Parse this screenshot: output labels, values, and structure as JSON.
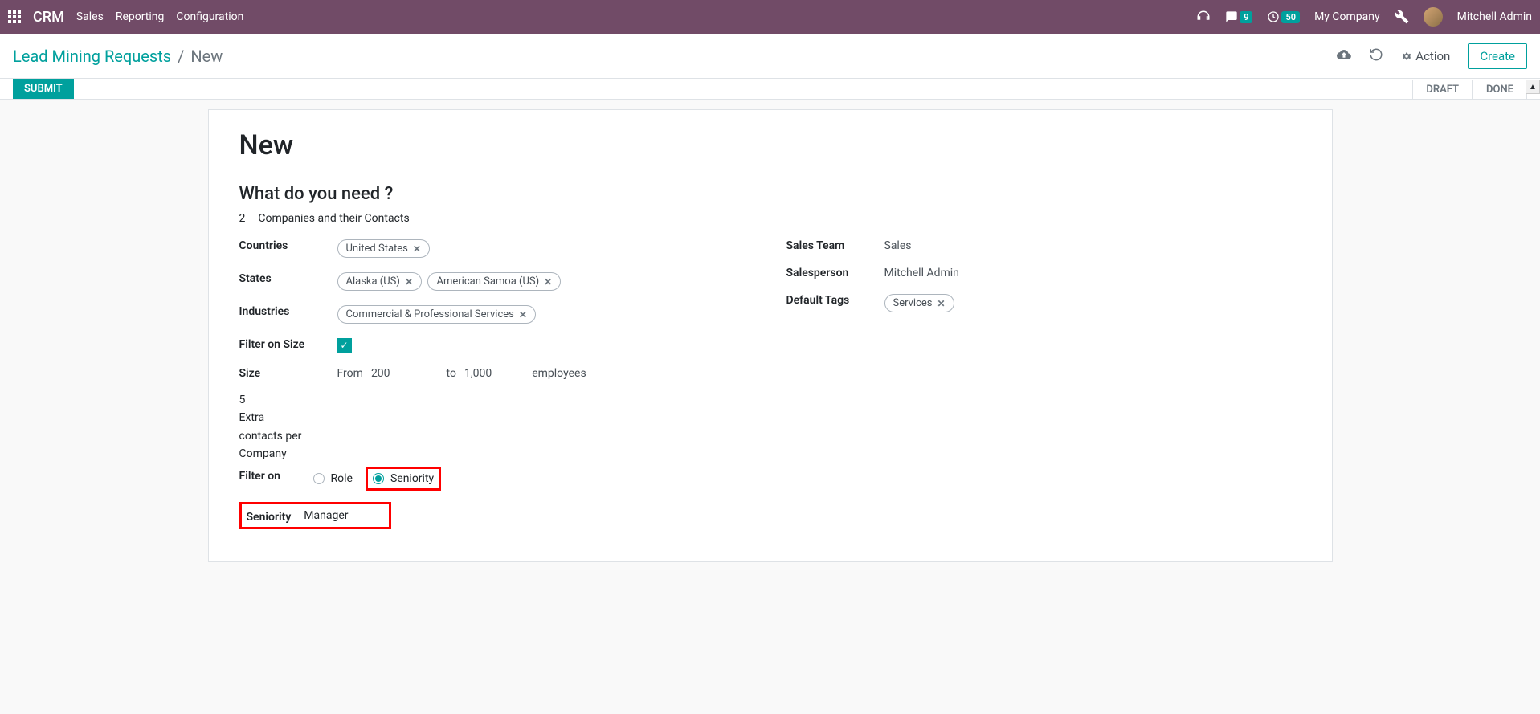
{
  "topbar": {
    "app_name": "CRM",
    "nav": [
      "Sales",
      "Reporting",
      "Configuration"
    ],
    "messages_count": "9",
    "timer_count": "50",
    "company": "My Company",
    "username": "Mitchell Admin"
  },
  "subheader": {
    "breadcrumb_root": "Lead Mining Requests",
    "breadcrumb_sep": "/",
    "breadcrumb_current": "New",
    "action_label": "Action",
    "create_label": "Create"
  },
  "status": {
    "submit_label": "SUBMIT",
    "stage_draft": "DRAFT",
    "stage_done": "DONE"
  },
  "form": {
    "title": "New",
    "section_question": "What do you need ?",
    "qty": "2",
    "qty_desc": "Companies and their Contacts",
    "labels": {
      "countries": "Countries",
      "states": "States",
      "industries": "Industries",
      "filter_size": "Filter on Size",
      "size": "Size",
      "size_from": "From",
      "size_to": "to",
      "size_unit": "employees",
      "extra_qty": "5",
      "extra_desc_l1": "Extra",
      "extra_desc_l2": "contacts per",
      "extra_desc_l3": "Company",
      "filter_on": "Filter on",
      "role": "Role",
      "seniority_radio": "Seniority",
      "seniority_label": "Seniority",
      "sales_team": "Sales Team",
      "salesperson": "Salesperson",
      "default_tags": "Default Tags"
    },
    "values": {
      "countries": [
        "United States"
      ],
      "states": [
        "Alaska (US)",
        "American Samoa (US)"
      ],
      "industries": [
        "Commercial & Professional Services"
      ],
      "size_from": "200",
      "size_to": "1,000",
      "seniority": "Manager",
      "sales_team": "Sales",
      "salesperson": "Mitchell Admin",
      "default_tags": [
        "Services"
      ]
    }
  }
}
